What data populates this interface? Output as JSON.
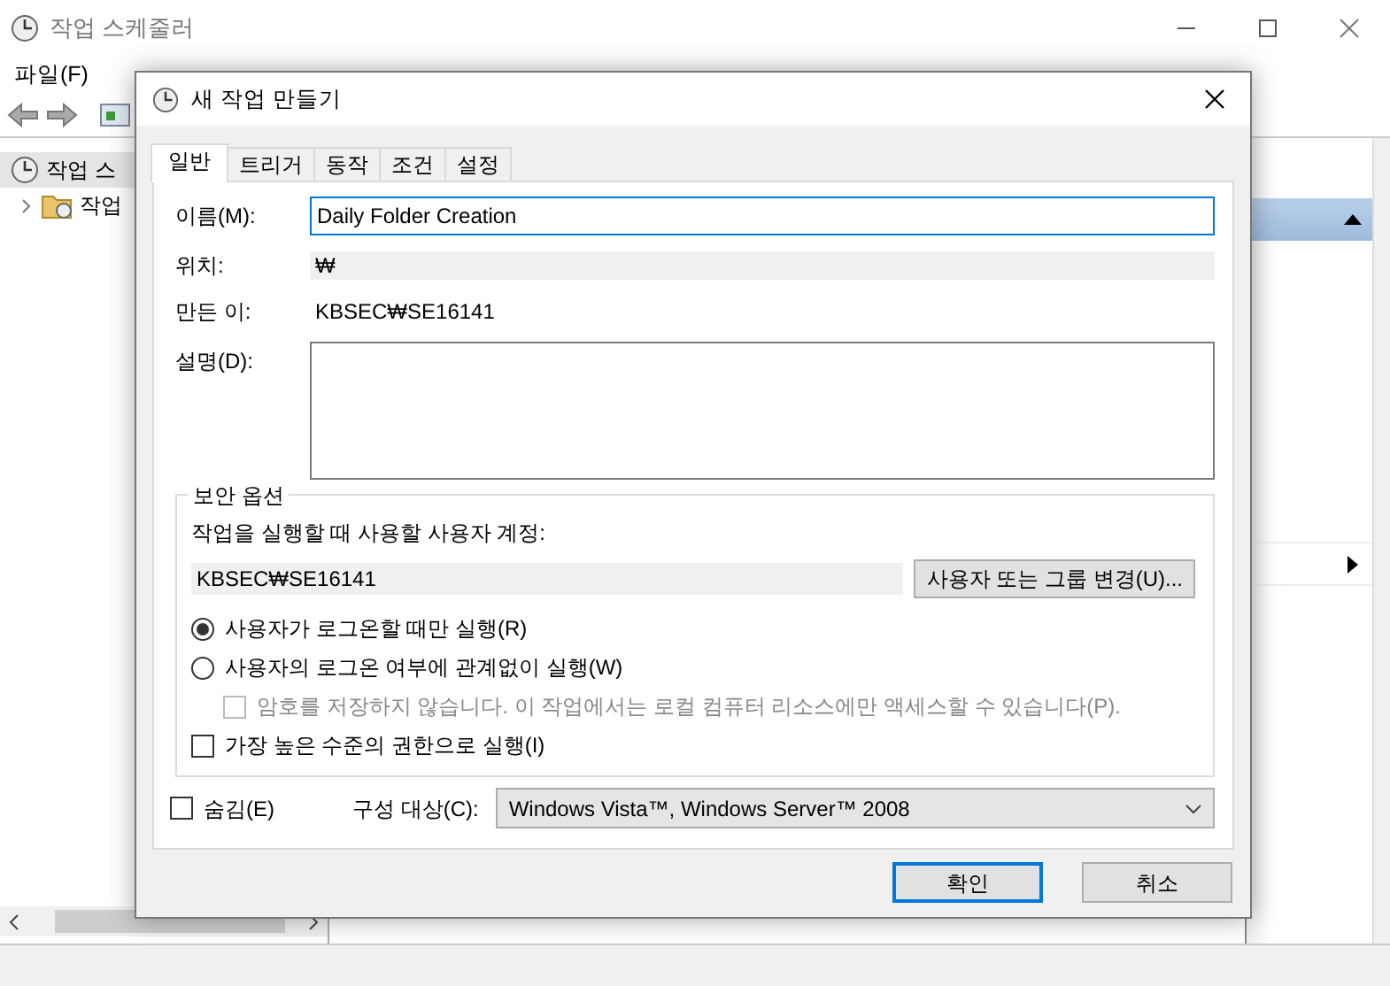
{
  "main_window": {
    "title": "작업 스케줄러",
    "menu": [
      "파일(F)"
    ],
    "tree": [
      {
        "label": "작업 스",
        "children": [
          {
            "label": "작업",
            "expanded": false
          }
        ]
      }
    ]
  },
  "dialog": {
    "title": "새 작업 만들기",
    "tabs": [
      {
        "label": "일반",
        "selected": true
      },
      {
        "label": "트리거",
        "selected": false
      },
      {
        "label": "동작",
        "selected": false
      },
      {
        "label": "조건",
        "selected": false
      },
      {
        "label": "설정",
        "selected": false
      }
    ],
    "name": {
      "label": "이름(M):",
      "value": "Daily Folder Creation"
    },
    "location": {
      "label": "위치:",
      "value": "₩"
    },
    "author": {
      "label": "만든 이:",
      "value": "KBSEC₩SE16141"
    },
    "description": {
      "label": "설명(D):"
    },
    "security": {
      "title": "보안 옵션",
      "account_label": "작업을 실행할 때 사용할 사용자 계정:",
      "account": "KBSEC₩SE16141",
      "change_button": "사용자 또는 그룹 변경(U)...",
      "options": [
        {
          "kind": "radio",
          "label": "사용자가 로그온할 때만 실행(R)",
          "selected": true
        },
        {
          "kind": "radio",
          "label": "사용자의 로그온 여부에 관계없이 실행(W)",
          "selected": false,
          "children": [
            {
              "kind": "checkbox",
              "label": "암호를 저장하지 않습니다. 이 작업에서는 로컬 컴퓨터 리소스에만 액세스할 수 있습니다(P).",
              "checked": false,
              "disabled": true
            }
          ]
        },
        {
          "kind": "checkbox",
          "label": "가장 높은 수준의 권한으로 실행(I)",
          "checked": false,
          "disabled": false
        }
      ]
    },
    "hidden": {
      "label": "숨김(E)",
      "checked": false
    },
    "configure": {
      "label": "구성 대상(C):",
      "value": "Windows Vista™, Windows Server™ 2008"
    },
    "buttons": [
      {
        "label": "확인",
        "default": true
      },
      {
        "label": "취소",
        "default": false
      }
    ]
  }
}
